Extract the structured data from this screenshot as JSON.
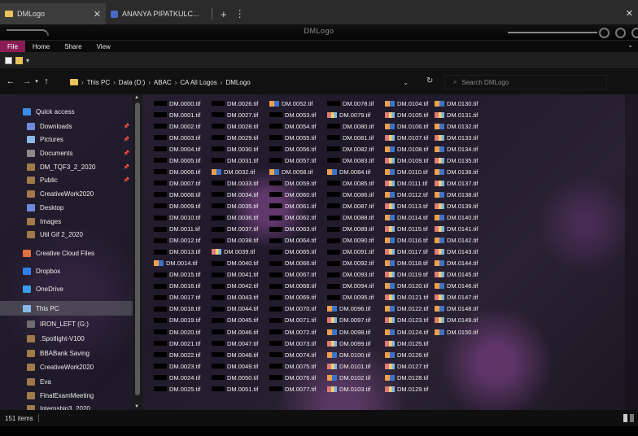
{
  "tabs": [
    {
      "label": "DMLogo",
      "active": true
    },
    {
      "label": "ANANYA PIPATKULC...",
      "active": false
    }
  ],
  "window_title": "DMLogo",
  "ribbon": {
    "file": "File",
    "tabs": [
      "Home",
      "Share",
      "View"
    ]
  },
  "address": {
    "segments": [
      "This PC",
      "Data (D:)",
      "ABAC",
      "CA All Logos",
      "DMLogo"
    ]
  },
  "search": {
    "placeholder": "Search DMLogo"
  },
  "nav": [
    {
      "label": "Quick access",
      "icon": "star-icon",
      "color": "#3c8ee8",
      "pinned": false
    },
    {
      "label": "Downloads",
      "icon": "download-folder-icon",
      "color": "#6f8ad8",
      "pinned": true
    },
    {
      "label": "Pictures",
      "icon": "pictures-folder-icon",
      "color": "#8ab8e8",
      "pinned": true
    },
    {
      "label": "Documents",
      "icon": "documents-folder-icon",
      "color": "#8a8a8a",
      "pinned": true
    },
    {
      "label": "DM_TQF3_2_2020",
      "icon": "folder-icon",
      "color": "#a07a4a",
      "pinned": true
    },
    {
      "label": "Public",
      "icon": "folder-icon",
      "color": "#a07a4a",
      "pinned": true
    },
    {
      "label": "CreativeWork2020",
      "icon": "folder-icon",
      "color": "#a07a4a",
      "pinned": false
    },
    {
      "label": "Desktop",
      "icon": "desktop-folder-icon",
      "color": "#6f8ad8",
      "pinned": false
    },
    {
      "label": "Images",
      "icon": "folder-icon",
      "color": "#a07a4a",
      "pinned": false
    },
    {
      "label": "Util Gif 2_2020",
      "icon": "folder-icon",
      "color": "#a07a4a",
      "pinned": false
    },
    {
      "label": "Creative Cloud Files",
      "icon": "creative-cloud-icon",
      "color": "#e07040",
      "pinned": false
    },
    {
      "label": "Dropbox",
      "icon": "dropbox-icon",
      "color": "#2f7ee8",
      "pinned": false
    },
    {
      "label": "OneDrive",
      "icon": "onedrive-icon",
      "color": "#3a9be8",
      "pinned": false
    },
    {
      "label": "This PC",
      "icon": "computer-icon",
      "color": "#8ab8e8",
      "pinned": false
    },
    {
      "label": "IRON_LEFT (G:)",
      "icon": "drive-icon",
      "color": "#6f6f6f",
      "pinned": false
    },
    {
      "label": ".Spotlight-V100",
      "icon": "folder-icon",
      "color": "#a07a4a",
      "pinned": false
    },
    {
      "label": "BBABank Saving",
      "icon": "folder-icon",
      "color": "#a07a4a",
      "pinned": false
    },
    {
      "label": "CreativeWork2020",
      "icon": "folder-icon",
      "color": "#a07a4a",
      "pinned": false
    },
    {
      "label": "Eva",
      "icon": "folder-icon",
      "color": "#a07a4a",
      "pinned": false
    },
    {
      "label": "FinalExamMeeting",
      "icon": "folder-icon",
      "color": "#a07a4a",
      "pinned": false
    },
    {
      "label": "Internship3_2020",
      "icon": "folder-icon",
      "color": "#a07a4a",
      "pinned": false
    }
  ],
  "files": {
    "prefix": "DM.",
    "ext": ".tif",
    "count": 151,
    "rows_per_column": 26,
    "logo_thumbs": [
      14,
      32,
      39,
      52,
      58,
      79,
      84,
      96,
      97,
      98,
      99,
      100,
      101,
      102,
      103,
      104,
      105,
      106,
      107,
      108,
      109,
      110,
      111,
      112,
      113,
      114,
      115,
      116,
      117,
      118,
      119,
      120,
      121,
      122,
      123,
      124,
      125,
      126,
      127,
      128,
      129,
      130,
      131,
      132,
      133,
      134,
      135,
      136,
      137,
      138,
      139,
      140,
      141,
      142,
      143,
      144,
      145,
      146,
      147,
      148,
      149,
      150
    ]
  },
  "status": {
    "item_count": "151 items"
  }
}
